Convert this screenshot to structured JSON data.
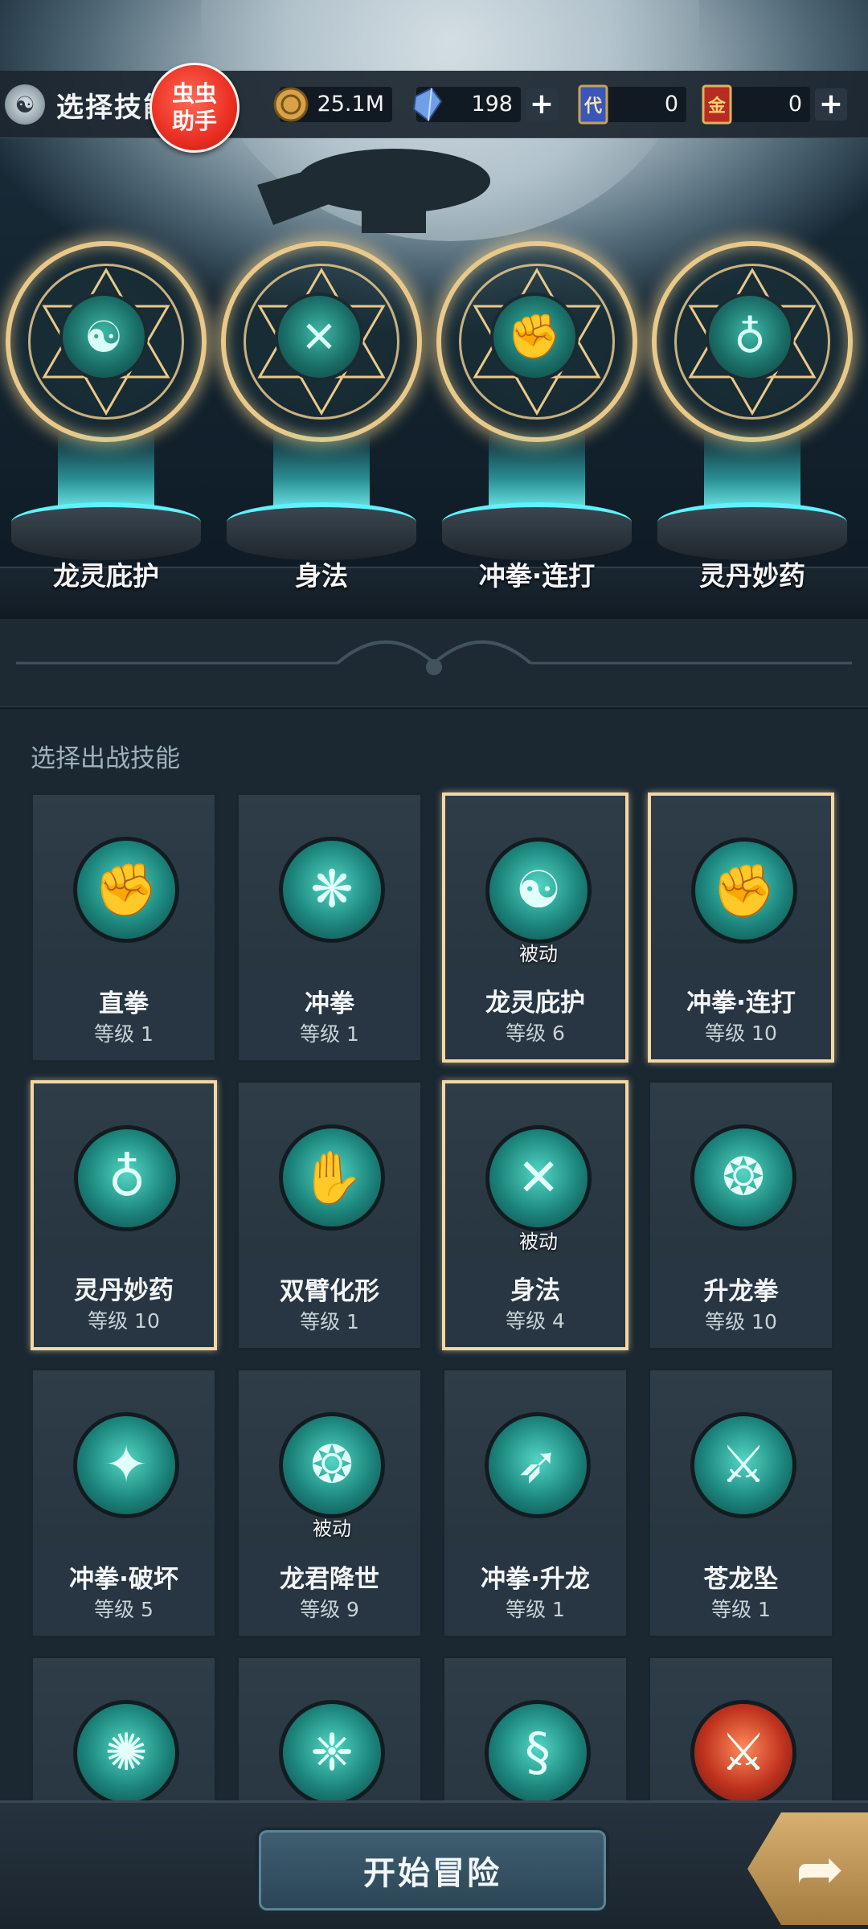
{
  "header": {
    "title": "选择技能",
    "helper_badge": [
      "虫虫",
      "助手"
    ]
  },
  "resources": [
    {
      "name": "coin",
      "icon": "coin-icon",
      "value": "25.1M",
      "has_plus": false
    },
    {
      "name": "crystal",
      "icon": "crystal-icon",
      "value": "198",
      "has_plus": true
    },
    {
      "name": "voucher",
      "icon": "voucher-card-icon",
      "icon_text": "代",
      "value": "0",
      "has_plus": false
    },
    {
      "name": "gold-card",
      "icon": "gold-card-icon",
      "icon_text": "金",
      "value": "0",
      "has_plus": true
    }
  ],
  "equipped": [
    {
      "label": "龙灵庇护",
      "icon": "dragon-spirit-icon"
    },
    {
      "label": "身法",
      "icon": "agility-icon"
    },
    {
      "label": "冲拳·连打",
      "icon": "rush-punch-combo-icon"
    },
    {
      "label": "灵丹妙药",
      "icon": "elixir-gourd-icon"
    }
  ],
  "list": {
    "title": "选择出战技能",
    "passive_label": "被动",
    "skills": [
      {
        "name": "直拳",
        "level": "等级 1",
        "equipped": false,
        "passive": false,
        "icon": "straight-punch-icon"
      },
      {
        "name": "冲拳",
        "level": "等级 1",
        "equipped": false,
        "passive": false,
        "icon": "rush-punch-icon"
      },
      {
        "name": "龙灵庇护",
        "level": "等级 6",
        "equipped": true,
        "passive": true,
        "icon": "dragon-spirit-icon"
      },
      {
        "name": "冲拳·连打",
        "level": "等级 10",
        "equipped": true,
        "passive": false,
        "icon": "rush-punch-combo-icon"
      },
      {
        "name": "灵丹妙药",
        "level": "等级 10",
        "equipped": true,
        "passive": false,
        "icon": "elixir-gourd-icon"
      },
      {
        "name": "双臂化形",
        "level": "等级 1",
        "equipped": false,
        "passive": false,
        "icon": "twin-arms-icon"
      },
      {
        "name": "身法",
        "level": "等级 4",
        "equipped": true,
        "passive": true,
        "icon": "agility-icon"
      },
      {
        "name": "升龙拳",
        "level": "等级 10",
        "equipped": false,
        "passive": false,
        "icon": "rising-dragon-icon"
      },
      {
        "name": "冲拳·破坏",
        "level": "等级 5",
        "equipped": false,
        "passive": false,
        "icon": "rush-punch-break-icon"
      },
      {
        "name": "龙君降世",
        "level": "等级 9",
        "equipped": false,
        "passive": true,
        "icon": "dragon-lord-icon"
      },
      {
        "name": "冲拳·升龙",
        "level": "等级 1",
        "equipped": false,
        "passive": false,
        "icon": "rush-punch-rise-icon"
      },
      {
        "name": "苍龙坠",
        "level": "等级 1",
        "equipped": false,
        "passive": false,
        "icon": "azure-dragon-fall-icon"
      },
      {
        "name": "",
        "level": "",
        "equipped": false,
        "passive": false,
        "icon": "whirl-strike-icon"
      },
      {
        "name": "",
        "level": "",
        "equipped": false,
        "passive": false,
        "icon": "claw-strike-icon"
      },
      {
        "name": "",
        "level": "",
        "equipped": false,
        "passive": false,
        "icon": "coiled-dragon-icon"
      },
      {
        "name": "",
        "level": "",
        "equipped": false,
        "passive": false,
        "icon": "fire-sword-icon",
        "color": "red"
      }
    ]
  },
  "footer": {
    "start_button": "开始冒险",
    "next_icon": "forward-arrow-icon"
  }
}
